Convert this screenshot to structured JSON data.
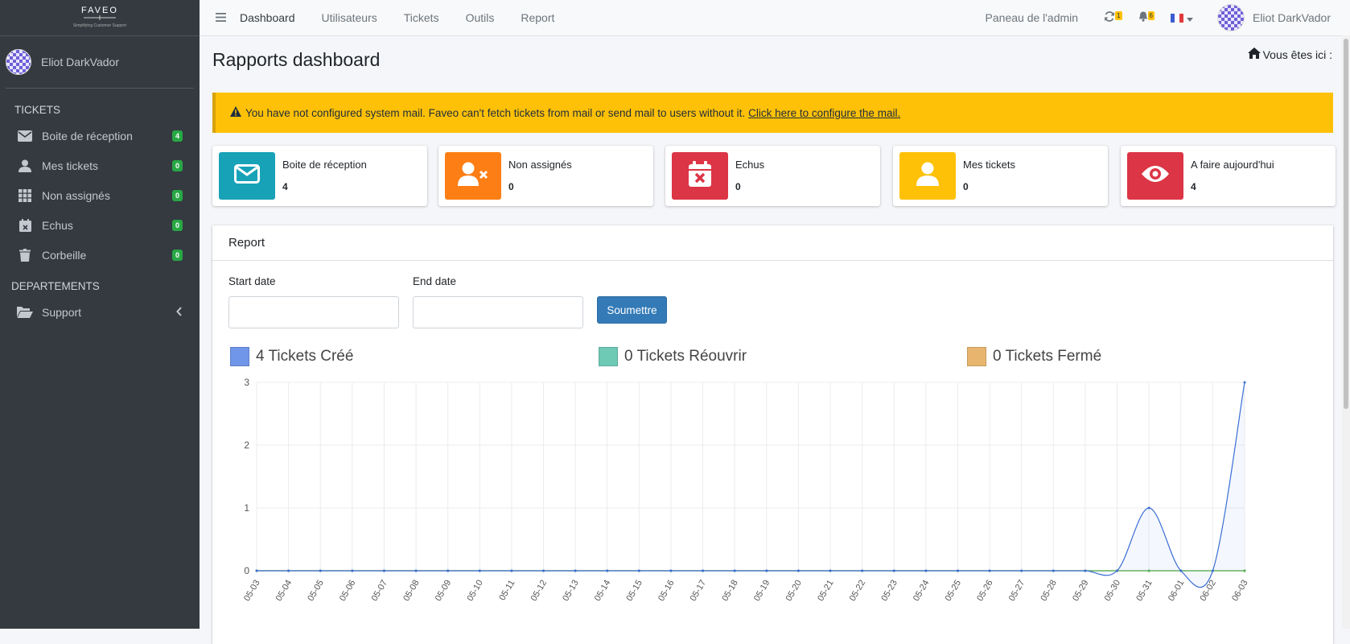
{
  "brand": {
    "name": "FAVEO",
    "tagline": "Simplifying Customer Support"
  },
  "user": {
    "name": "Eliot DarkVador"
  },
  "sidebar": {
    "tickets_header": "TICKETS",
    "items": [
      {
        "label": "Boite de réception",
        "count": "4",
        "icon": "envelope-icon"
      },
      {
        "label": "Mes tickets",
        "count": "0",
        "icon": "user-icon"
      },
      {
        "label": "Non assignés",
        "count": "0",
        "icon": "grid-icon"
      },
      {
        "label": "Echus",
        "count": "0",
        "icon": "calendar-x-icon"
      },
      {
        "label": "Corbeille",
        "count": "0",
        "icon": "trash-icon"
      }
    ],
    "departments_header": "DEPARTEMENTS",
    "departments": [
      {
        "label": "Support",
        "icon": "folder-open-icon"
      }
    ]
  },
  "topbar": {
    "nav": [
      "Dashboard",
      "Utilisateurs",
      "Tickets",
      "Outils",
      "Report"
    ],
    "admin_link": "Paneau de l'admin",
    "sync_count": "1",
    "notif_count": "6",
    "user_name": "Eliot DarkVador"
  },
  "page": {
    "title": "Rapports dashboard",
    "breadcrumb": "Vous êtes ici :"
  },
  "alert": {
    "text": "You have not configured system mail. Faveo can't fetch tickets from mail or send mail to users without it.",
    "link": "Click here to configure the mail."
  },
  "info_boxes": [
    {
      "label": "Boite de réception",
      "value": "4",
      "color": "#17a2b8",
      "icon": "envelope-icon"
    },
    {
      "label": "Non assignés",
      "value": "0",
      "color": "#fd7e14",
      "icon": "user-x-icon"
    },
    {
      "label": "Echus",
      "value": "0",
      "color": "#dc3545",
      "icon": "calendar-x-icon"
    },
    {
      "label": "Mes tickets",
      "value": "0",
      "color": "#ffc107",
      "icon": "user-icon"
    },
    {
      "label": "A faire aujourd'hui",
      "value": "4",
      "color": "#dc3545",
      "icon": "eye-icon"
    }
  ],
  "report": {
    "title": "Report",
    "start_label": "Start date",
    "end_label": "End date",
    "submit": "Soumettre"
  },
  "legend": [
    {
      "text": "4 Tickets Créé",
      "color": "#6f96e8"
    },
    {
      "text": "0 Tickets Réouvrir",
      "color": "#6ec9b5"
    },
    {
      "text": "0 Tickets Fermé",
      "color": "#e8b56f"
    }
  ],
  "chart_data": {
    "type": "line",
    "x": [
      "05-03",
      "05-04",
      "05-05",
      "05-06",
      "05-07",
      "05-08",
      "05-09",
      "05-10",
      "05-11",
      "05-12",
      "05-13",
      "05-14",
      "05-15",
      "05-16",
      "05-17",
      "05-18",
      "05-19",
      "05-20",
      "05-21",
      "05-22",
      "05-23",
      "05-24",
      "05-25",
      "05-26",
      "05-27",
      "05-28",
      "05-29",
      "05-30",
      "05-31",
      "06-01",
      "06-02",
      "06-03"
    ],
    "series": [
      {
        "name": "Tickets Créé",
        "color": "#3b6fd4",
        "values": [
          0,
          0,
          0,
          0,
          0,
          0,
          0,
          0,
          0,
          0,
          0,
          0,
          0,
          0,
          0,
          0,
          0,
          0,
          0,
          0,
          0,
          0,
          0,
          0,
          0,
          0,
          0,
          0,
          1,
          0,
          0,
          3
        ]
      },
      {
        "name": "Tickets Réouvrir",
        "color": "#4caf50",
        "values": [
          0,
          0,
          0,
          0,
          0,
          0,
          0,
          0,
          0,
          0,
          0,
          0,
          0,
          0,
          0,
          0,
          0,
          0,
          0,
          0,
          0,
          0,
          0,
          0,
          0,
          0,
          0,
          0,
          0,
          0,
          0,
          0
        ]
      },
      {
        "name": "Tickets Fermé",
        "color": "#e8b56f",
        "values": [
          0,
          0,
          0,
          0,
          0,
          0,
          0,
          0,
          0,
          0,
          0,
          0,
          0,
          0,
          0,
          0,
          0,
          0,
          0,
          0,
          0,
          0,
          0,
          0,
          0,
          0,
          0,
          0,
          0,
          0,
          0,
          0
        ]
      }
    ],
    "ylim": [
      0,
      3
    ],
    "yticks": [
      0,
      1,
      2,
      3
    ],
    "grid": true
  }
}
